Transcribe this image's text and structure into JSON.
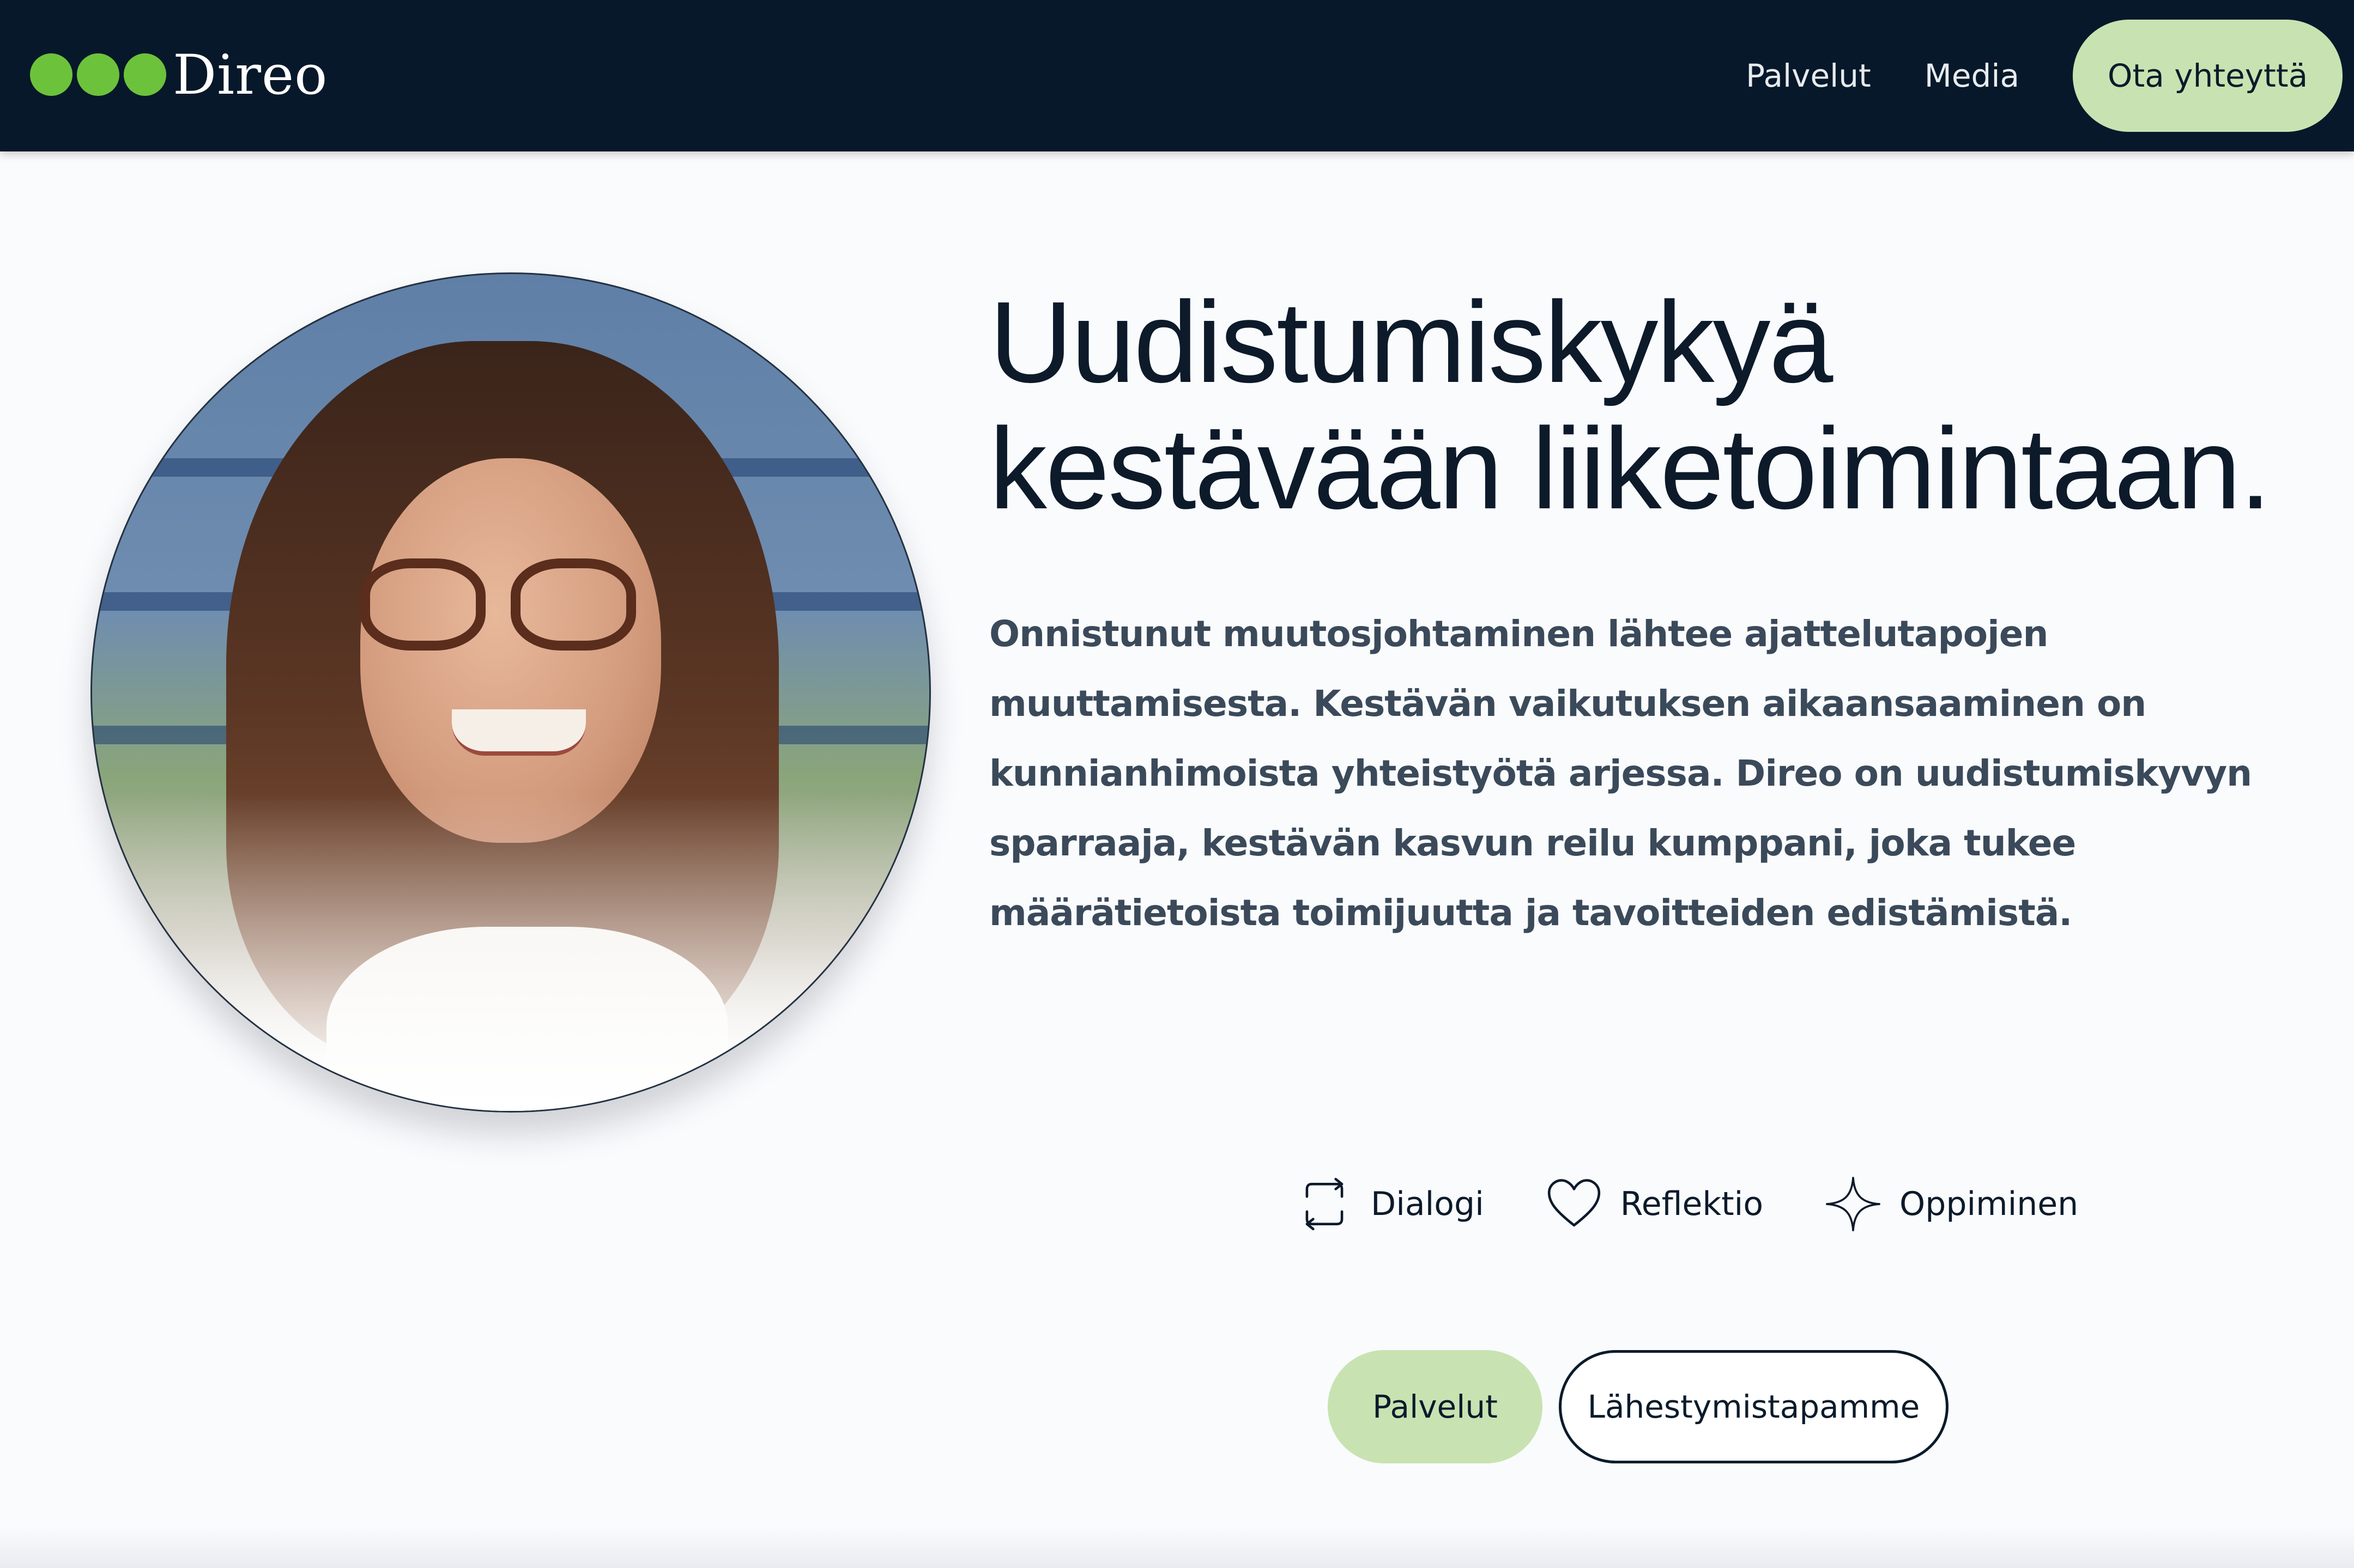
{
  "header": {
    "logo_text": "Direo",
    "brand_color": "#6cc33b",
    "background_color": "#07182a",
    "nav": [
      {
        "label": "Palvelut"
      },
      {
        "label": "Media"
      }
    ],
    "cta_label": "Ota yhteyttä",
    "cta_color": "#c8e3b1"
  },
  "hero": {
    "headline_line1": "Uudistumiskykyä",
    "headline_line2": "kestävään liiketoimintaan.",
    "intro": "Onnistunut muutosjohtaminen lähtee ajattelutapojen muuttamisesta. Kestävän vaikutuksen aikaansaaminen on kunnianhimoista yhteistyötä arjessa. Direo on uudistumiskyvyn sparraaja, kestävän kasvun reilu kumppani, joka tukee määrätietoista toimijuutta ja tavoitteiden edistämistä.",
    "portrait_icon": "portrait-photo"
  },
  "values": [
    {
      "label": "Dialogi",
      "icon": "repeat-arrows-icon"
    },
    {
      "label": "Reflektio",
      "icon": "heart-icon"
    },
    {
      "label": "Oppiminen",
      "icon": "sparkle-icon"
    }
  ],
  "actions": {
    "primary_label": "Palvelut",
    "secondary_label": "Lähestymistapamme"
  }
}
